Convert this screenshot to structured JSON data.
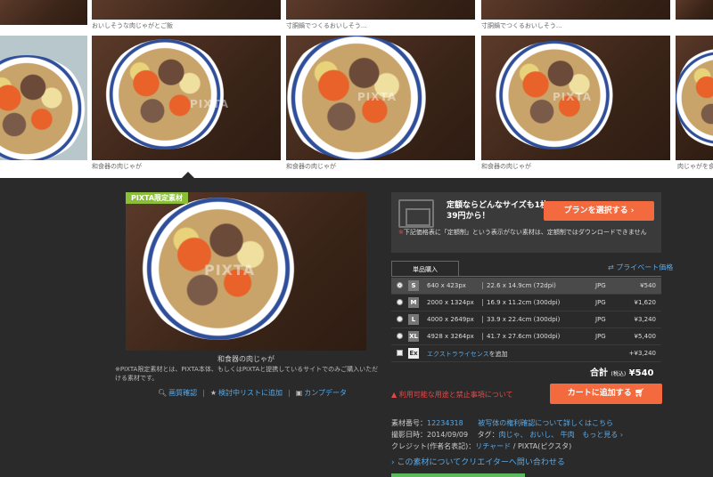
{
  "gallery": {
    "top_captions": [
      "おいしそうな肉じゃがとご飯",
      "寸胴鍋でつくるおいしそう...",
      "寸胴鍋でつくるおいしそう..."
    ],
    "thumb_captions": [
      "和食器の肉じゃが",
      "和食器の肉じゃが",
      "和食器の肉じゃが",
      "肉じゃがを食べる"
    ],
    "watermark": "PIXTA"
  },
  "preview": {
    "badge": "PIXTA限定素材",
    "caption": "和食器の肉じゃが",
    "note": "※PIXTA限定素材とは、PIXTA本体、もしくはPIXTAと提携しているサイトでのみご購入いただける素材です。",
    "links": {
      "zoom": "画質確認",
      "favorite": "検討中リストに追加",
      "comp": "カンプデータ"
    }
  },
  "promo": {
    "title": "定額ならどんなサイズも1枚39円から！",
    "button": "プランを選択する",
    "note_star": "※",
    "note": "下記価格表に「定額制」という表示がない素材は、定額制ではダウンロードできません"
  },
  "tabs": {
    "single": "単品購入",
    "private": "プライベート価格"
  },
  "sizes": [
    {
      "code": "S",
      "px": "640 x 423px",
      "cm": "22.6 x 14.9cm (72dpi)",
      "format": "JPG",
      "price": "¥540",
      "selected": true
    },
    {
      "code": "M",
      "px": "2000 x 1324px",
      "cm": "16.9 x 11.2cm (300dpi)",
      "format": "JPG",
      "price": "¥1,620",
      "selected": false
    },
    {
      "code": "L",
      "px": "4000 x 2649px",
      "cm": "33.9 x 22.4cm (300dpi)",
      "format": "JPG",
      "price": "¥3,240",
      "selected": false
    },
    {
      "code": "XL",
      "px": "4928 x 3264px",
      "cm": "41.7 x 27.6cm (300dpi)",
      "format": "JPG",
      "price": "¥5,400",
      "selected": false
    }
  ],
  "extended": {
    "code": "Ex",
    "label": "エクストラライセンス",
    "suffix": "を追加",
    "price": "+¥3,240"
  },
  "total": {
    "label": "合計",
    "tax": "(税込)",
    "amount": "¥540"
  },
  "warning": "利用可能な用途と禁止事項について",
  "cart_button": "カートに追加する",
  "meta": {
    "id_label": "素材番号：",
    "id": "12234318",
    "rights_link": "被写体の権利確認について詳しくはこちら",
    "date_label": "撮影日時：",
    "date": "2014/09/09",
    "tags_label": "タグ：",
    "tags": "肉じゃ、 おいし、 牛肉",
    "more": "もっと見る",
    "credit_label": "クレジット(作者名表記)：",
    "credit_name": "リチャード",
    "credit_suffix": " / PIXTA(ピクスタ)"
  },
  "contact": "この素材についてクリエイターへ問い合わせる"
}
